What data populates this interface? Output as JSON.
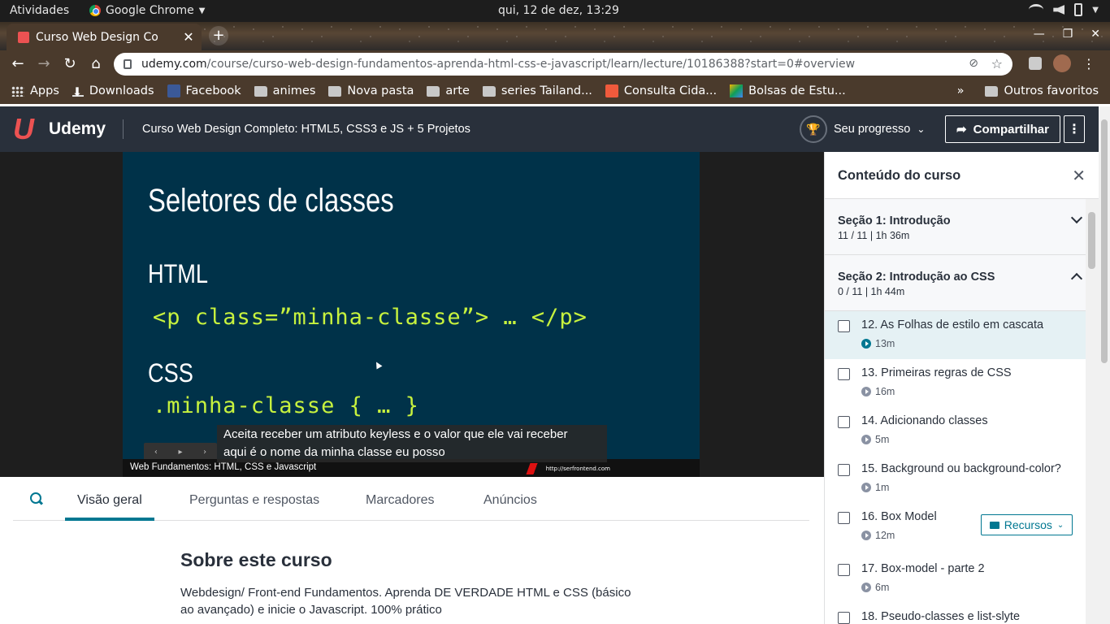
{
  "system_bar": {
    "activities": "Atividades",
    "app_name": "Google Chrome",
    "clock": "qui, 12 de dez, 13:29"
  },
  "browser": {
    "tab_title": "Curso Web Design Co",
    "url_host": "udemy.com",
    "url_path": "/course/curso-web-design-fundamentos-aprenda-html-css-e-javascript/learn/lecture/10186388?start=0#overview",
    "bookmarks": [
      {
        "label": "Apps",
        "icon": "apps-icon"
      },
      {
        "label": "Downloads",
        "icon": "download-icon"
      },
      {
        "label": "Facebook",
        "icon": "facebook-icon"
      },
      {
        "label": "animes",
        "icon": "folder-icon"
      },
      {
        "label": "Nova pasta",
        "icon": "folder-icon"
      },
      {
        "label": "arte",
        "icon": "folder-icon"
      },
      {
        "label": "series Tailand...",
        "icon": "folder-icon"
      },
      {
        "label": "Consulta Cida...",
        "icon": "site-icon"
      },
      {
        "label": "Bolsas de Estu...",
        "icon": "site-icon"
      }
    ],
    "more_bookmarks": "»",
    "other_bookmarks": "Outros favoritos"
  },
  "header": {
    "logo_text": "Udemy",
    "course_title": "Curso Web Design Completo: HTML5, CSS3 e JS + 5 Projetos",
    "progress_label": "Seu progresso",
    "share_label": "Compartilhar"
  },
  "slide": {
    "title": "Seletores de classes",
    "heading_html": "HTML",
    "code_html": "<p class=”minha-classe”> … </p>",
    "heading_css": "CSS",
    "code_css": ".minha-classe { … }",
    "footer": "Web Fundamentos: HTML, CSS e Javascript",
    "brand": "http://serfrontend.com",
    "caption_line1": "Aceita receber um atributo keyless e o valor que ele vai receber",
    "caption_line2": "aqui é o nome da minha classe eu posso"
  },
  "lecture_tabs": [
    "Visão geral",
    "Perguntas e respostas",
    "Marcadores",
    "Anúncios"
  ],
  "about": {
    "heading": "Sobre este curso",
    "text": "Webdesign/ Front-end Fundamentos. Aprenda DE VERDADE HTML e CSS (básico ao avançado) e inicie o Javascript. 100% prático"
  },
  "sidebar": {
    "title": "Conteúdo do curso",
    "sections": [
      {
        "name": "Seção 1: Introdução",
        "meta": "11 / 11 | 1h 36m",
        "expanded": false
      },
      {
        "name": "Seção 2: Introdução ao CSS",
        "meta": "0 / 11 | 1h 44m",
        "expanded": true
      }
    ],
    "lectures": [
      {
        "title": "12. As Folhas de estilo em cascata",
        "duration": "13m",
        "current": true
      },
      {
        "title": "13. Primeiras regras de CSS",
        "duration": "16m"
      },
      {
        "title": "14. Adicionando classes",
        "duration": "5m"
      },
      {
        "title": "15. Background ou background-color?",
        "duration": "1m"
      },
      {
        "title": "16. Box Model",
        "duration": "12m",
        "resources": "Recursos"
      },
      {
        "title": "17. Box-model - parte 2",
        "duration": "6m"
      },
      {
        "title": "18. Pseudo-classes e list-slyte",
        "duration": ""
      }
    ]
  },
  "colors": {
    "udemy_red": "#ec5252",
    "header_bg": "#29303b",
    "accent": "#007791",
    "slide_bg": "#003249",
    "code_green": "#c7f23e"
  }
}
